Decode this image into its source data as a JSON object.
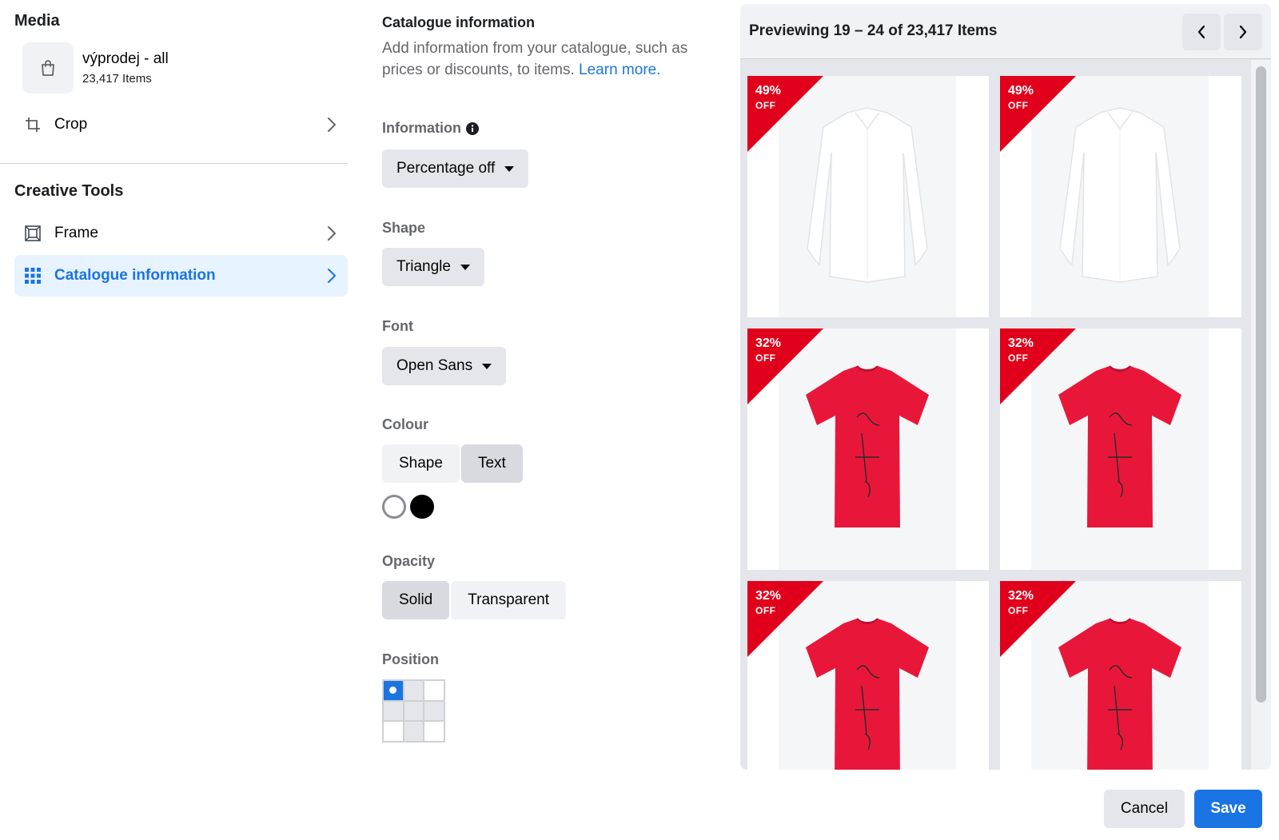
{
  "left": {
    "media_title": "Media",
    "media_name": "výprodej - all",
    "media_count": "23,417 Items",
    "crop_label": "Crop",
    "tools_title": "Creative Tools",
    "frame_label": "Frame",
    "catalogue_label": "Catalogue information"
  },
  "mid": {
    "title": "Catalogue information",
    "description": "Add information from your catalogue, such as prices or discounts, to items.",
    "learn_more": "Learn more.",
    "information_label": "Information",
    "information_value": "Percentage off",
    "shape_label": "Shape",
    "shape_value": "Triangle",
    "font_label": "Font",
    "font_value": "Open Sans",
    "colour_label": "Colour",
    "colour_tabs": [
      "Shape",
      "Text"
    ],
    "colour_selected_tab": "Text",
    "swatches": [
      "#ffffff",
      "#000000"
    ],
    "opacity_label": "Opacity",
    "opacity_options": [
      "Solid",
      "Transparent"
    ],
    "opacity_selected": "Solid",
    "position_label": "Position",
    "position_selected": "top-left"
  },
  "preview": {
    "title": "Previewing 19 – 24 of 23,417 Items",
    "items": [
      {
        "pct": "49%",
        "off": "OFF",
        "product": "white-shirt"
      },
      {
        "pct": "49%",
        "off": "OFF",
        "product": "white-shirt"
      },
      {
        "pct": "32%",
        "off": "OFF",
        "product": "red-tshirt"
      },
      {
        "pct": "32%",
        "off": "OFF",
        "product": "red-tshirt"
      },
      {
        "pct": "32%",
        "off": "OFF",
        "product": "red-tshirt"
      },
      {
        "pct": "32%",
        "off": "OFF",
        "product": "red-tshirt"
      }
    ]
  },
  "footer": {
    "cancel_label": "Cancel",
    "save_label": "Save"
  },
  "colors": {
    "accent": "#1b74e4",
    "badge": "#e0001b",
    "tshirt": "#e8173a"
  }
}
